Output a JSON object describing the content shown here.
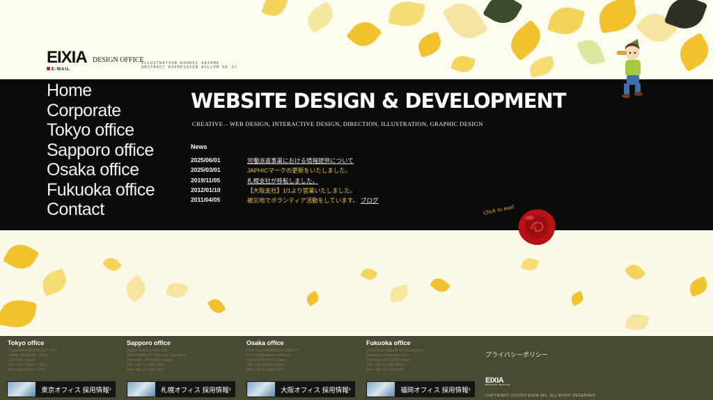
{
  "logo": {
    "main": "EIXIA",
    "sub": "DESIGN OFFICE",
    "mail": "E-MAIL"
  },
  "tagline": {
    "line1": "ILLUSTRATION KOUHEI SAYAMA",
    "line2": "ABSTRACT EXPRESSION WILLEM DE JJ"
  },
  "nav": [
    "Home",
    "Corporate",
    "Tokyo office",
    "Sapporo office",
    "Osaka office",
    "Fukuoka office",
    "Contact"
  ],
  "hero": {
    "title": "WEBSITE DESIGN & DEVELOPMENT",
    "subtitle": "CREATIVE – WEB DESIGN, INTERACTIVE DESIGN, DIRECTION, ILLUSTRATION, GRAPHIC DESIGN"
  },
  "news": {
    "heading": "News",
    "items": [
      {
        "date": "2025/06/01",
        "text": "労働派遣事業における情報提供について"
      },
      {
        "date": "2025/03/01",
        "text": "JAPHICマークの更新をいたしました。"
      },
      {
        "date": "2019/11/05",
        "text": "札幌支社が移転しました。"
      },
      {
        "date": "2012/01/10",
        "text": "【大阪支社】1/1より営業いたしました。"
      },
      {
        "date": "2011/04/05",
        "text": "被災地でボランティア活動をしています。",
        "link": "ブログ"
      }
    ]
  },
  "click_to_mail": "Click to mail",
  "offices": [
    {
      "name": "Tokyo office",
      "address": "Toranomon Odaiba 15F 2-3-1\nDaiba, Minato-ku, Tokyo\n135-0091 Japan\nTEL:+81-3-6457-1201 /\nFAX:+81-3-6457-1205",
      "recruit": "東京オフィス 採用情報"
    },
    {
      "name": "Sapporo office",
      "address": "Sanyo Odori Center 10F\nOdori-Nishi 3-7, Chuo-ku, Sapporo\nHokkaido, 060-0042 Japan\nTEL:+81-11-598-7142 /\nFAX:+81-11-598-7143",
      "recruit": "札幌オフィス 採用情報"
    },
    {
      "name": "Osaka office",
      "address": "Park Court Nishitenma bldg 5F\n4-10-5 Nishitenma Kita-ku\nOsaka,530-0047 Japan\nTEL:+81-6-6940-5617 /\nFAX:+81-6-6940-5627",
      "recruit": "大阪オフィス 採用情報"
    },
    {
      "name": "Fukuoka office",
      "address": "Liens Gion bldg 8F 2-8 Gionchou,\nHakata-ku,Fukuoka City\nFukuoka, 812-0038 Japan\nTEL:+81-92-263-8500 /\nFAX:+81-92-263-8501",
      "recruit": "福岡オフィス 採用情報"
    }
  ],
  "privacy": "プライバシーポリシー",
  "footer_logo": {
    "main": "EIXIA",
    "sub": "DESIGN OFFICE"
  },
  "copyright": "COPYRIGHT (C)2010 EIXIA INC. ALL RIGHT RESERVED.",
  "colors": {
    "band": "#0b0b0a",
    "news_accent": "#f2c038",
    "footer": "#4a4933",
    "seal": "#b81216",
    "leaf": "#f2c12e"
  }
}
